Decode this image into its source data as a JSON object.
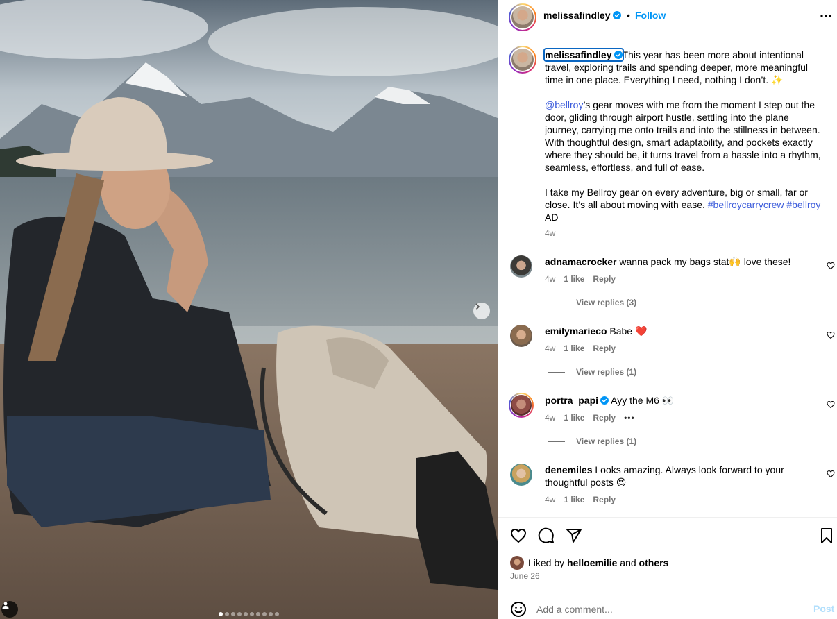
{
  "post": {
    "username": "melissafindley",
    "follow_label": "Follow",
    "separator": "•",
    "caption_paragraphs": {
      "p1": "This year has been more about intentional travel, exploring trails and spending deeper, more meaningful time in one place. Everything I need, nothing I don’t. ✨",
      "p2_mention": "@bellroy",
      "p2_rest": "’s gear moves with me from the moment I step out the door, gliding through airport hustle, settling into the plane journey, carrying me onto trails and into the stillness in between. With thoughtful design, smart adaptability, and pockets exactly where they should be, it turns travel from a hassle into a rhythm, seamless, effortless, and full of ease.",
      "p3_text": "I take my Bellroy gear on every adventure, big or small, far or close. It’s all about moving with ease. ",
      "p3_tag1": "#bellroycarrycrew",
      "p3_tag2": "#bellroy",
      "p3_end": " AD"
    },
    "caption_time": "4w",
    "liked_by_prefix": "Liked by ",
    "liked_by_user": "helloemilie",
    "liked_by_and": " and ",
    "liked_by_others": "others",
    "date": "June 26",
    "carousel_total_dots": 10,
    "carousel_active_index": 0
  },
  "comments": [
    {
      "user": "adnamacrocker",
      "text": "wanna pack my bags stat🙌 love these!",
      "time": "4w",
      "likes": "1 like",
      "reply": "Reply",
      "view_replies": "View replies (3)",
      "verified": false
    },
    {
      "user": "emilymarieco",
      "text": "Babe ❤️",
      "time": "4w",
      "likes": "1 like",
      "reply": "Reply",
      "view_replies": "View replies (1)",
      "verified": false
    },
    {
      "user": "portra_papi",
      "text": "Ayy the M6 👀",
      "time": "4w",
      "likes": "1 like",
      "reply": "Reply",
      "more": "•••",
      "view_replies": "View replies (1)",
      "verified": true
    },
    {
      "user": "denemiles",
      "text": "Looks amazing. Always look forward to your thoughtful posts 😍",
      "time": "4w",
      "likes": "1 like",
      "reply": "Reply",
      "verified": false
    }
  ],
  "add_comment": {
    "placeholder": "Add a comment...",
    "post_label": "Post"
  },
  "icons": {
    "more": "more-horizontal-icon",
    "like": "heart-icon",
    "comment": "speech-bubble-icon",
    "share": "paper-plane-icon",
    "save": "bookmark-icon",
    "emoji": "smiley-icon",
    "next": "chevron-right-icon",
    "verified": "verified-badge-icon",
    "tag": "person-tag-icon"
  },
  "colors": {
    "link_blue": "#0095f6",
    "text_secondary": "#737373",
    "hashtag": "#3b5bdb"
  }
}
